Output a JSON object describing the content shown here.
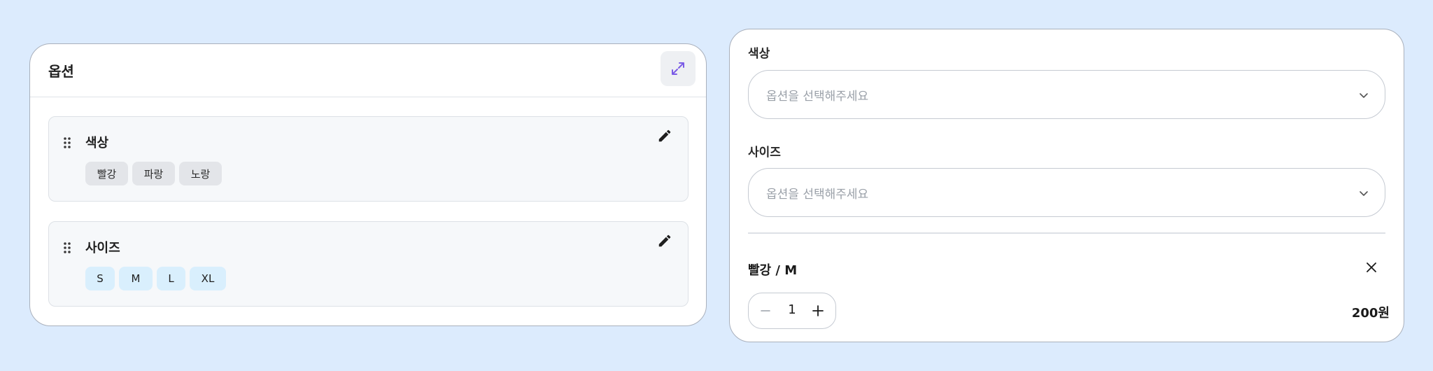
{
  "option_panel": {
    "title": "옵션",
    "groups": [
      {
        "name": "색상",
        "values": [
          "빨강",
          "파랑",
          "노랑"
        ]
      },
      {
        "name": "사이즈",
        "values": [
          "S",
          "M",
          "L",
          "XL"
        ]
      }
    ]
  },
  "preview": {
    "fields": [
      {
        "label": "색상",
        "placeholder": "옵션을 선택해주세요"
      },
      {
        "label": "사이즈",
        "placeholder": "옵션을 선택해주세요"
      }
    ],
    "selected_item": {
      "name": "빨강 / M",
      "quantity": "1",
      "price": "200원"
    }
  },
  "colors": {
    "background": "#dcebfd",
    "accent": "#7b5ce6",
    "chip_gray": "#e3e5e9",
    "chip_blue": "#d9effd"
  },
  "icons": {
    "expand": "expand-arrows-icon",
    "drag": "drag-handle-icon",
    "edit": "pencil-icon",
    "chevron": "chevron-down-icon",
    "close": "close-icon",
    "minus": "minus-icon",
    "plus": "plus-icon"
  }
}
